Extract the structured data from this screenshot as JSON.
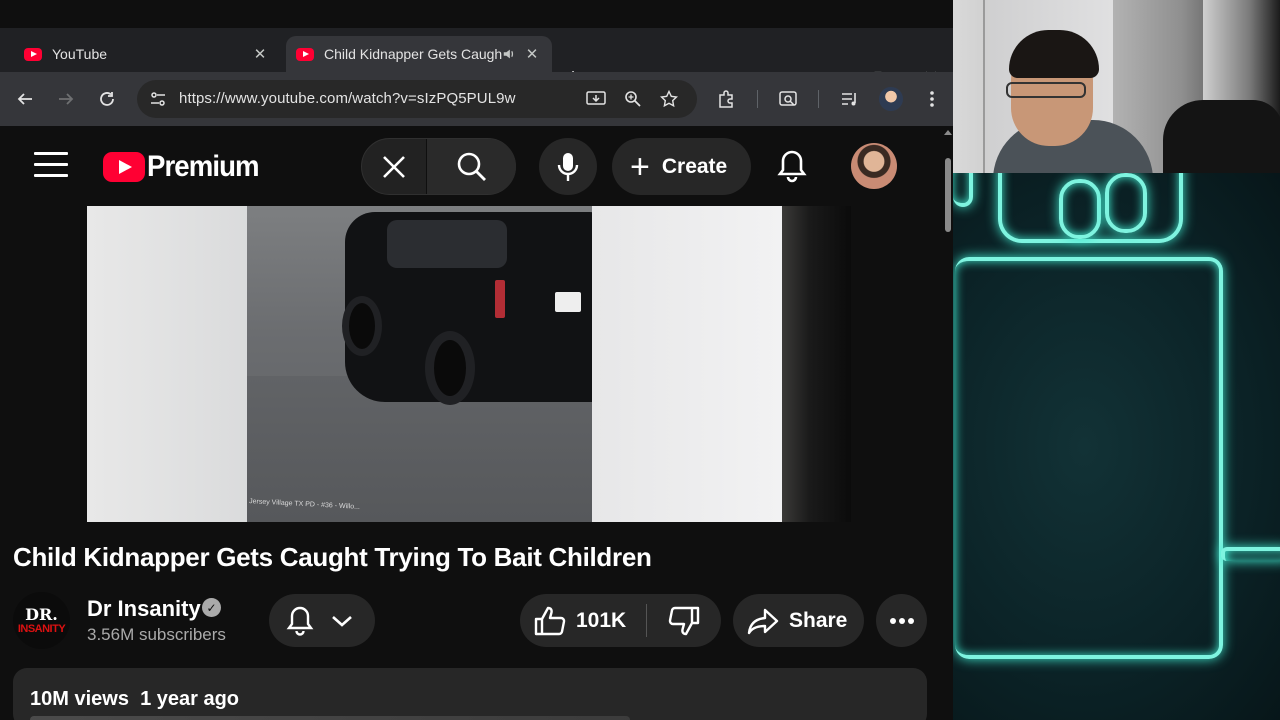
{
  "browser": {
    "tabs": [
      {
        "title": "YouTube",
        "active": false
      },
      {
        "title": "Child Kidnapper Gets Caught Trying To Bait Children",
        "active": true,
        "audio": true
      }
    ],
    "new_tab_label": "+",
    "url": "https://www.youtube.com/watch?v=sIzPQ5PUL9w"
  },
  "youtube": {
    "logo_text": "Premium",
    "create_label": "Create",
    "video": {
      "caption": "Jersey Village TX PD - #36 - Willo...",
      "title": "Child Kidnapper Gets Caught Trying To Bait Children"
    },
    "channel": {
      "name": "Dr Insanity",
      "avatar_line1": "DR.",
      "avatar_line2": "INSANITY",
      "subscribers": "3.56M subscribers",
      "verified": true
    },
    "actions": {
      "like_count": "101K",
      "share_label": "Share"
    },
    "description": {
      "views": "10M views",
      "age": "1 year ago"
    }
  },
  "colors": {
    "youtube_red": "#ff0033",
    "page_bg": "#0f0f0f",
    "button_bg": "#272727",
    "neon": "#7ef4e0"
  },
  "icons": [
    "youtube-favicon",
    "close-icon",
    "audio-icon",
    "back-icon",
    "forward-icon",
    "reload-icon",
    "site-settings-icon",
    "install-icon",
    "zoom-icon",
    "star-icon",
    "extensions-icon",
    "lens-icon",
    "media-icon",
    "profile-icon",
    "kebab-icon",
    "menu-icon",
    "mic-icon",
    "search-icon",
    "bell-icon",
    "verified-icon",
    "notify-bell-icon",
    "chevron-down-icon",
    "thumbs-up-icon",
    "thumbs-down-icon",
    "share-icon",
    "more-icon"
  ]
}
